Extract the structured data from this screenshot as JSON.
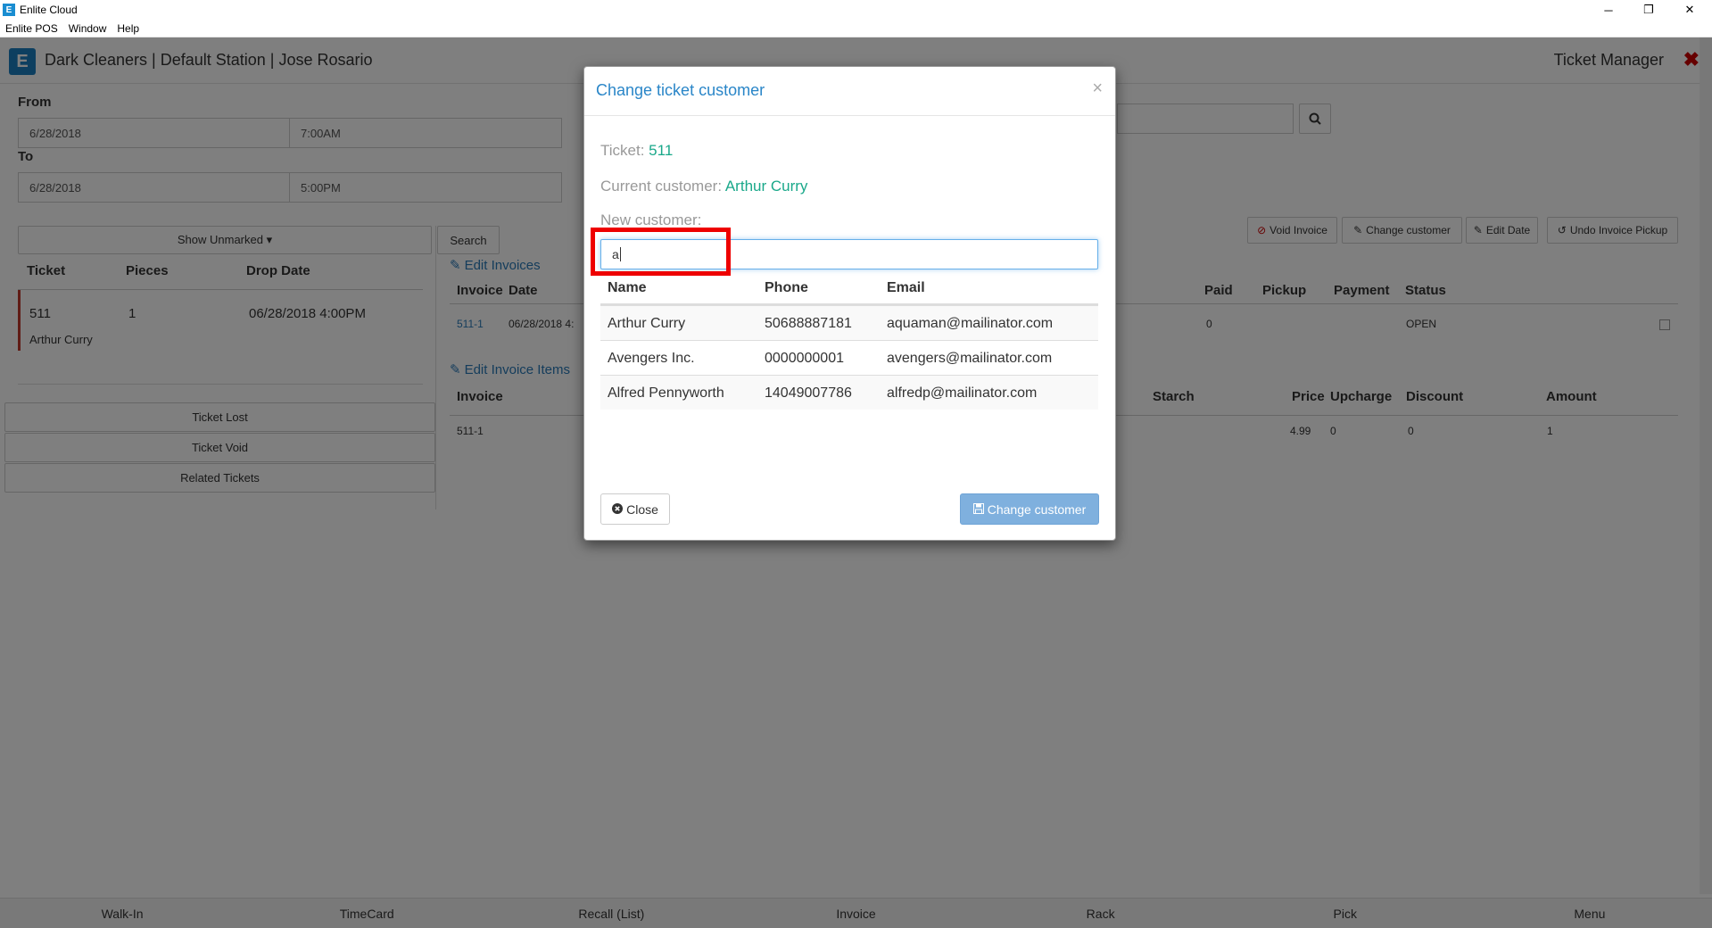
{
  "window": {
    "title": "Enlite Cloud",
    "icon_letter": "E",
    "minimize_glyph": "─",
    "restore_glyph": "❐",
    "close_glyph": "✕"
  },
  "menu": [
    "Enlite POS",
    "Window",
    "Help"
  ],
  "header": {
    "logo_letter": "E",
    "title": "Dark Cleaners | Default Station | Jose Rosario",
    "section": "Ticket Manager",
    "close_glyph": "✖"
  },
  "filters": {
    "from_label": "From",
    "from_date": "6/28/2018",
    "from_time": "7:00AM",
    "to_label": "To",
    "to_date": "6/28/2018",
    "to_time": "5:00PM",
    "show_unmarked": "Show Unmarked ▾",
    "search": "Search"
  },
  "ticket_table": {
    "headers": [
      "Ticket",
      "Pieces",
      "Drop Date"
    ],
    "rows": [
      {
        "ticket": "511",
        "pieces": "1",
        "drop_date": "06/28/2018 4:00PM",
        "customer": "Arthur Curry"
      }
    ]
  },
  "side_buttons": [
    "Ticket Lost",
    "Ticket Void",
    "Related Tickets"
  ],
  "invoices": {
    "edit_link": "Edit Invoices",
    "headers": {
      "invoice": "Invoice",
      "date": "Date",
      "paid": "Paid",
      "pickup": "Pickup",
      "payment": "Payment",
      "status": "Status"
    },
    "row": {
      "invoice": "511-1",
      "date": "06/28/2018 4:",
      "paid": "0",
      "status": "OPEN"
    },
    "action_buttons": [
      "Void Invoice",
      "Change customer",
      "Edit Date",
      "Undo Invoice Pickup"
    ]
  },
  "invoice_items": {
    "edit_link": "Edit Invoice Items",
    "headers": {
      "invoice": "Invoice",
      "starch": "Starch",
      "price": "Price",
      "upcharge": "Upcharge",
      "discount": "Discount",
      "amount": "Amount"
    },
    "row": {
      "invoice": "511-1",
      "price": "4.99",
      "upcharge": "0",
      "discount": "0",
      "amount": "1"
    }
  },
  "bottom_nav": [
    "Walk-In",
    "TimeCard",
    "Recall (List)",
    "Invoice",
    "Rack",
    "Pick",
    "Menu"
  ],
  "modal": {
    "title": "Change ticket customer",
    "close_x": "×",
    "ticket_label": "Ticket:",
    "ticket_value": "511",
    "current_label": "Current customer:",
    "current_value": "Arthur Curry",
    "new_label": "New customer:",
    "search_value": "a",
    "table_headers": [
      "Name",
      "Phone",
      "Email"
    ],
    "results": [
      {
        "name": "Arthur Curry",
        "phone": "50688887181",
        "email": "aquaman@mailinator.com"
      },
      {
        "name": "Avengers Inc.",
        "phone": "0000000001",
        "email": "avengers@mailinator.com"
      },
      {
        "name": "Alfred Pennyworth",
        "phone": "14049007786",
        "email": "alfredp@mailinator.com"
      }
    ],
    "close_button": "Close",
    "change_button": "Change customer"
  },
  "colors": {
    "accent": "#2a86c8",
    "value_green": "#1aa88a",
    "highlight": "#e00000",
    "primary_button": "#7fb0de"
  }
}
